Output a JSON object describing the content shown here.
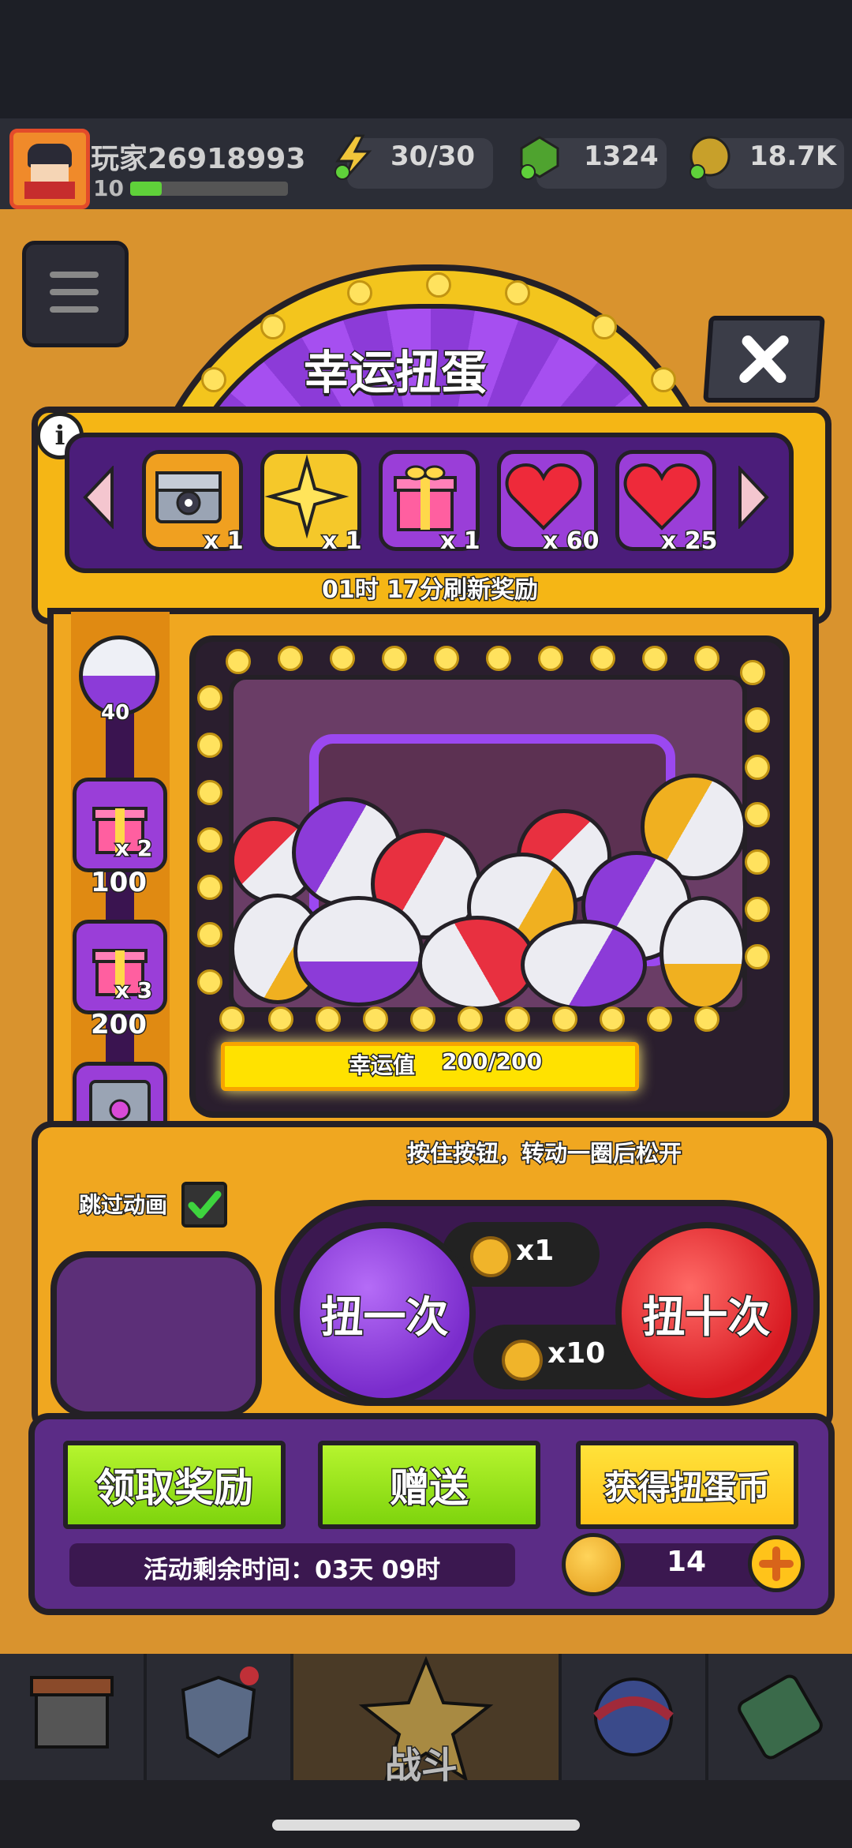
{
  "player": {
    "name": "玩家26918993",
    "level": "10"
  },
  "resources": {
    "energy": "30/30",
    "gems": "1324",
    "coins": "18.7K"
  },
  "machine": {
    "title": "幸运扭蛋",
    "refresh_text": "01时 17分刷新奖励",
    "prizes": [
      {
        "icon": "chest-icon",
        "count": "x 1"
      },
      {
        "icon": "star-icon",
        "count": "x 1"
      },
      {
        "icon": "gift-icon",
        "count": "x 1"
      },
      {
        "icon": "heart-icon",
        "count": "x 60"
      },
      {
        "icon": "heart-icon",
        "count": "x 25"
      }
    ],
    "milestones": [
      {
        "icon": "capsule-icon",
        "label": "40"
      },
      {
        "icon": "gift-icon",
        "count": "x 2",
        "label": "100"
      },
      {
        "icon": "gift-icon",
        "count": "x 3",
        "label": "200"
      },
      {
        "icon": "chest-icon"
      }
    ],
    "luck_label": "幸运值",
    "luck_value": "200/200",
    "hint": "按住按钮，转动一圈后松开",
    "skip_label": "跳过动画",
    "skip_checked": true,
    "spin_once": {
      "label": "扭一次",
      "cost": "x1"
    },
    "spin_ten": {
      "label": "扭十次",
      "cost": "x10"
    }
  },
  "actions": {
    "claim": "领取奖励",
    "gift": "赠送",
    "get_coins": "获得扭蛋币",
    "remaining_time": "活动剩余时间：03天 09时",
    "coin_count": "14"
  },
  "nav": {
    "battle": "战斗"
  },
  "colors": {
    "purple": "#8c3bd8",
    "yellow": "#f5b615",
    "green": "#8ee016",
    "red": "#e8202a"
  }
}
